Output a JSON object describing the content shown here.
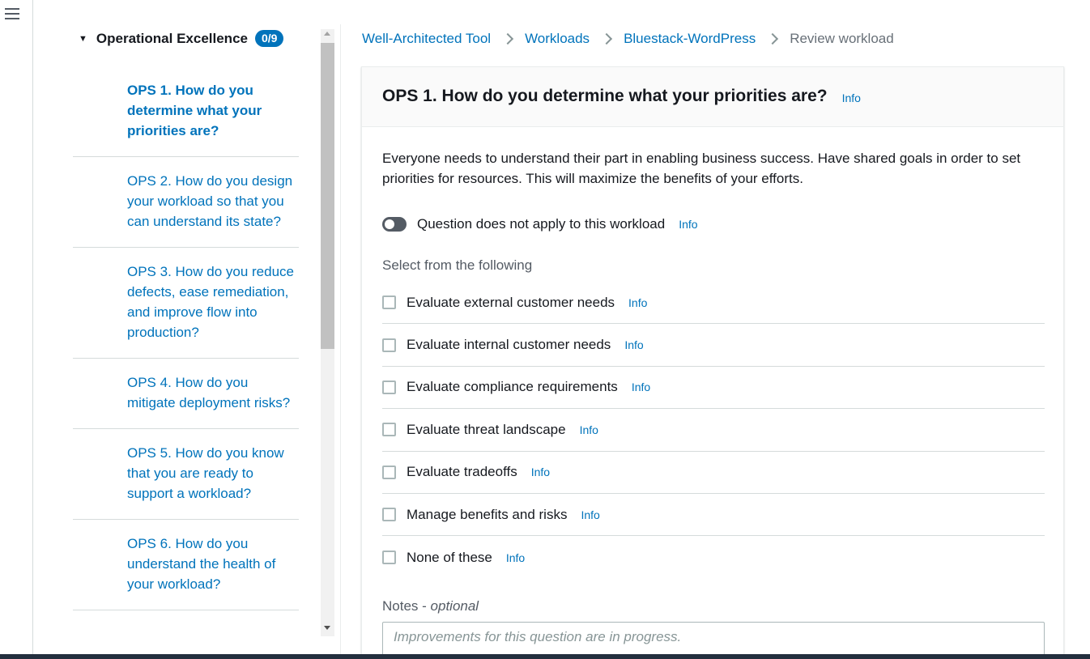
{
  "nav": {
    "pillar": {
      "label": "Operational Excellence",
      "count": "0/9"
    },
    "questions": [
      {
        "label": "OPS 1. How do you determine what your priorities are?"
      },
      {
        "label": "OPS 2. How do you design your workload so that you can understand its state?"
      },
      {
        "label": "OPS 3. How do you reduce defects, ease remediation, and improve flow into production?"
      },
      {
        "label": "OPS 4. How do you mitigate deployment risks?"
      },
      {
        "label": "OPS 5. How do you know that you are ready to support a workload?"
      },
      {
        "label": "OPS 6. How do you understand the health of your workload?"
      }
    ]
  },
  "breadcrumb": {
    "items": [
      "Well-Architected Tool",
      "Workloads",
      "Bluestack-WordPress"
    ],
    "current": "Review workload"
  },
  "question": {
    "title": "OPS 1. How do you determine what your priorities are?",
    "info": "Info",
    "description": "Everyone needs to understand their part in enabling business success. Have shared goals in order to set priorities for resources. This will maximize the benefits of your efforts.",
    "toggle_label": "Question does not apply to this workload",
    "select_label": "Select from the following",
    "choices": [
      {
        "label": "Evaluate external customer needs",
        "info": "Info"
      },
      {
        "label": "Evaluate internal customer needs",
        "info": "Info"
      },
      {
        "label": "Evaluate compliance requirements",
        "info": "Info"
      },
      {
        "label": "Evaluate threat landscape",
        "info": "Info"
      },
      {
        "label": "Evaluate tradeoffs",
        "info": "Info"
      },
      {
        "label": "Manage benefits and risks",
        "info": "Info"
      },
      {
        "label": "None of these",
        "info": "Info"
      }
    ],
    "notes_label": "Notes",
    "notes_optional": "optional",
    "notes_placeholder": "Improvements for this question are in progress."
  },
  "colors": {
    "accent": "#0073bb",
    "text": "#16191f",
    "muted": "#545b64"
  }
}
